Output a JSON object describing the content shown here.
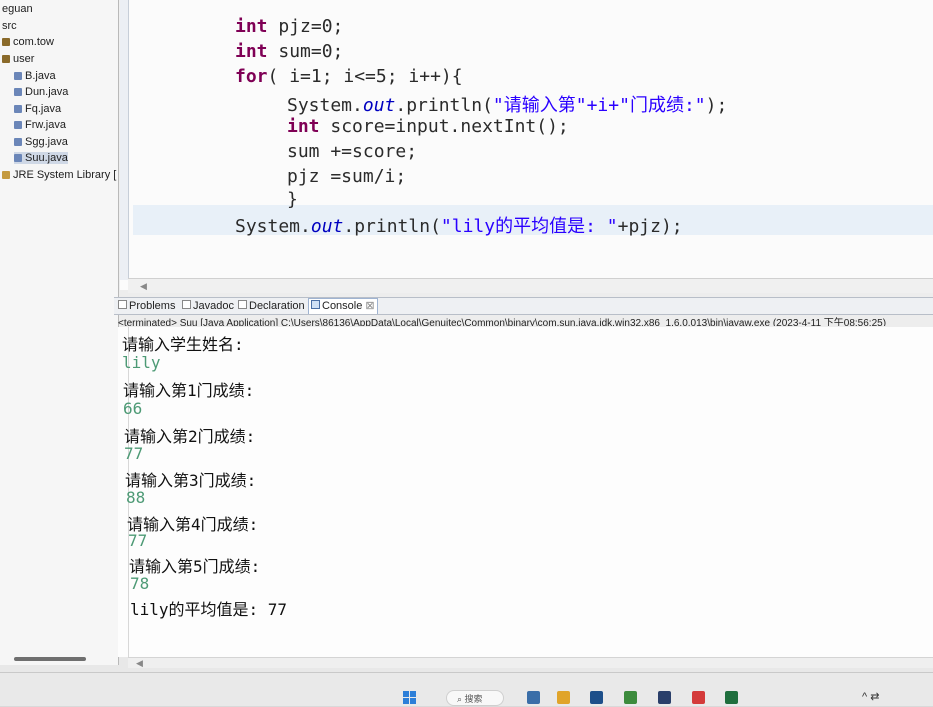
{
  "package_explorer": {
    "items": [
      {
        "label": "eguan",
        "icon": "project-icon"
      },
      {
        "label": "src",
        "icon": "folder-icon"
      },
      {
        "label": "com.tow",
        "icon": "package-icon"
      },
      {
        "label": "user",
        "icon": "package-icon"
      },
      {
        "label": "B.java",
        "icon": "java-file-icon"
      },
      {
        "label": "Dun.java",
        "icon": "java-file-icon"
      },
      {
        "label": "Fq.java",
        "icon": "java-file-icon"
      },
      {
        "label": "Frw.java",
        "icon": "java-file-icon"
      },
      {
        "label": "Sgg.java",
        "icon": "java-file-icon"
      },
      {
        "label": "Suu.java",
        "icon": "java-file-icon"
      },
      {
        "label": "JRE System Library [",
        "icon": "library-icon"
      }
    ],
    "selected": "Suu.java"
  },
  "editor": {
    "lines": [
      {
        "kw": "int",
        "rest": " pjz=0;"
      },
      {
        "kw": "int",
        "rest": " sum=0;"
      },
      {
        "kw": "for",
        "rest": "( i=1; i<=5; i++){"
      },
      {
        "pre": "System.",
        "field": "out",
        "mid": ".println(",
        "str": "\"请输入第\"+i+\"门成绩:\"",
        "post": ");"
      },
      {
        "kw": "int",
        "rest": " score=input.nextInt();"
      },
      {
        "text": "sum +=score;"
      },
      {
        "text": "pjz =sum/i;"
      },
      {
        "text": "}"
      },
      {
        "pre": "System.",
        "field": "out",
        "mid": ".println(",
        "str": "\"lily的平均值是: \"",
        "post": "+pjz);"
      }
    ]
  },
  "tabs": [
    {
      "label": "Problems",
      "icon": "problems-icon"
    },
    {
      "label": "Javadoc",
      "icon": "javadoc-icon"
    },
    {
      "label": "Declaration",
      "icon": "declaration-icon"
    },
    {
      "label": "Console",
      "icon": "console-icon",
      "active": true
    }
  ],
  "console": {
    "header": "<terminated> Suu [Java Application] C:\\Users\\86136\\AppData\\Local\\Genuitec\\Common\\binary\\com.sun.java.jdk.win32.x86_1.6.0.013\\bin\\javaw.exe (2023-4-11 下午08:56:25)",
    "lines": [
      {
        "text": "请输入学生姓名:",
        "type": "out"
      },
      {
        "text": "lily",
        "type": "in"
      },
      {
        "text": "请输入第1门成绩:",
        "type": "out"
      },
      {
        "text": "66",
        "type": "in"
      },
      {
        "text": "请输入第2门成绩:",
        "type": "out"
      },
      {
        "text": "77",
        "type": "in"
      },
      {
        "text": "请输入第3门成绩:",
        "type": "out"
      },
      {
        "text": "88",
        "type": "in"
      },
      {
        "text": "请输入第4门成绩:",
        "type": "out"
      },
      {
        "text": "77",
        "type": "in"
      },
      {
        "text": "请输入第5门成绩:",
        "type": "out"
      },
      {
        "text": "78",
        "type": "in"
      },
      {
        "text": "lily的平均值是: 77",
        "type": "out"
      }
    ]
  },
  "taskbar": {
    "search_label": "搜索",
    "tray": "^ ⇄"
  }
}
